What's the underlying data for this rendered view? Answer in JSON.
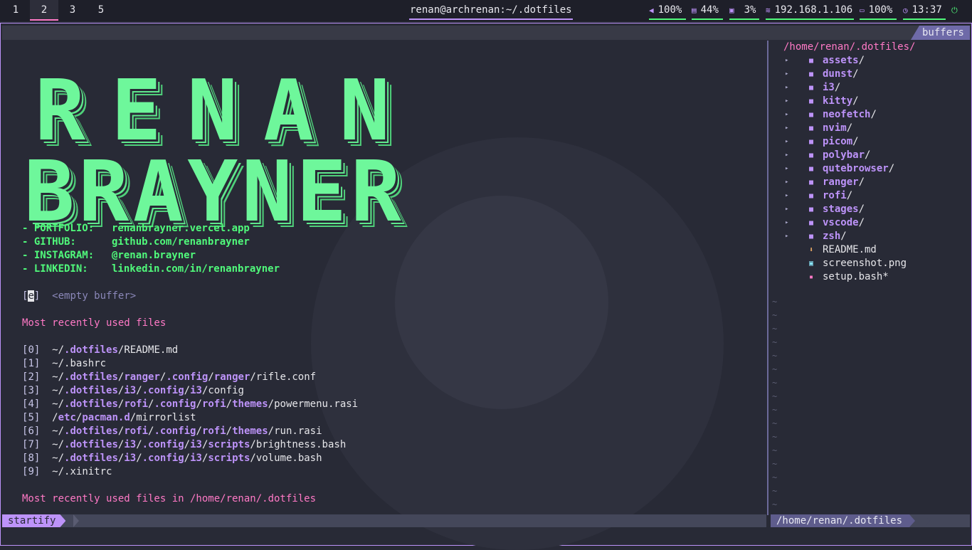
{
  "topbar": {
    "workspaces": [
      "1",
      "2",
      "3",
      "5"
    ],
    "active_workspace": "2",
    "window_title": "renan@archrenan:~/.dotfiles",
    "modules": {
      "volume": "100%",
      "memory": "44%",
      "cpu": "3%",
      "network": "192.168.1.106",
      "battery": "100%",
      "clock": "13:37"
    }
  },
  "tabline": {
    "buffers_label": "buffers"
  },
  "banner": {
    "line1": [
      "R",
      "E",
      "N",
      "A",
      "N"
    ],
    "line2": [
      "B",
      "R",
      "A",
      "Y",
      "N",
      "E",
      "R"
    ]
  },
  "info": [
    {
      "key": "- PORTFOLIO:",
      "value": "renanbrayner.vercel.app"
    },
    {
      "key": "- GITHUB:",
      "value": "github.com/renanbrayner"
    },
    {
      "key": "- INSTAGRAM:",
      "value": "@renan.brayner"
    },
    {
      "key": "- LINKEDIN:",
      "value": "linkedin.com/in/renanbrayner"
    }
  ],
  "empty_buffer": {
    "key": "e",
    "label": "<empty buffer>"
  },
  "mru": {
    "heading": "Most recently used files",
    "files": [
      {
        "index": "0",
        "parts": [
          [
            "~/",
            "p"
          ],
          [
            ".dotfiles",
            "d"
          ],
          [
            "/README.md",
            "p"
          ]
        ]
      },
      {
        "index": "1",
        "parts": [
          [
            "~/.bashrc",
            "p"
          ]
        ]
      },
      {
        "index": "2",
        "parts": [
          [
            "~/",
            "p"
          ],
          [
            ".dotfiles",
            "d"
          ],
          [
            "/",
            "p"
          ],
          [
            "ranger",
            "d"
          ],
          [
            "/",
            "p"
          ],
          [
            ".config",
            "d"
          ],
          [
            "/",
            "p"
          ],
          [
            "ranger",
            "d"
          ],
          [
            "/rifle.conf",
            "p"
          ]
        ]
      },
      {
        "index": "3",
        "parts": [
          [
            "~/",
            "p"
          ],
          [
            ".dotfiles",
            "d"
          ],
          [
            "/",
            "p"
          ],
          [
            "i3",
            "d"
          ],
          [
            "/",
            "p"
          ],
          [
            ".config",
            "d"
          ],
          [
            "/",
            "p"
          ],
          [
            "i3",
            "d"
          ],
          [
            "/config",
            "p"
          ]
        ]
      },
      {
        "index": "4",
        "parts": [
          [
            "~/",
            "p"
          ],
          [
            ".dotfiles",
            "d"
          ],
          [
            "/",
            "p"
          ],
          [
            "rofi",
            "d"
          ],
          [
            "/",
            "p"
          ],
          [
            ".config",
            "d"
          ],
          [
            "/",
            "p"
          ],
          [
            "rofi",
            "d"
          ],
          [
            "/",
            "p"
          ],
          [
            "themes",
            "d"
          ],
          [
            "/powermenu.rasi",
            "p"
          ]
        ]
      },
      {
        "index": "5",
        "parts": [
          [
            "/",
            "p"
          ],
          [
            "etc",
            "d"
          ],
          [
            "/",
            "p"
          ],
          [
            "pacman.d",
            "d"
          ],
          [
            "/mirrorlist",
            "p"
          ]
        ]
      },
      {
        "index": "6",
        "parts": [
          [
            "~/",
            "p"
          ],
          [
            ".dotfiles",
            "d"
          ],
          [
            "/",
            "p"
          ],
          [
            "rofi",
            "d"
          ],
          [
            "/",
            "p"
          ],
          [
            ".config",
            "d"
          ],
          [
            "/",
            "p"
          ],
          [
            "rofi",
            "d"
          ],
          [
            "/",
            "p"
          ],
          [
            "themes",
            "d"
          ],
          [
            "/run.rasi",
            "p"
          ]
        ]
      },
      {
        "index": "7",
        "parts": [
          [
            "~/",
            "p"
          ],
          [
            ".dotfiles",
            "d"
          ],
          [
            "/",
            "p"
          ],
          [
            "i3",
            "d"
          ],
          [
            "/",
            "p"
          ],
          [
            ".config",
            "d"
          ],
          [
            "/",
            "p"
          ],
          [
            "i3",
            "d"
          ],
          [
            "/",
            "p"
          ],
          [
            "scripts",
            "d"
          ],
          [
            "/brightness.bash",
            "p"
          ]
        ]
      },
      {
        "index": "8",
        "parts": [
          [
            "~/",
            "p"
          ],
          [
            ".dotfiles",
            "d"
          ],
          [
            "/",
            "p"
          ],
          [
            "i3",
            "d"
          ],
          [
            "/",
            "p"
          ],
          [
            ".config",
            "d"
          ],
          [
            "/",
            "p"
          ],
          [
            "i3",
            "d"
          ],
          [
            "/",
            "p"
          ],
          [
            "scripts",
            "d"
          ],
          [
            "/volume.bash",
            "p"
          ]
        ]
      },
      {
        "index": "9",
        "parts": [
          [
            "~/.xinitrc",
            "p"
          ]
        ]
      }
    ],
    "heading_dir": "Most recently used files in /home/renan/.dotfiles"
  },
  "tree": {
    "root": "/home/renan/.dotfiles/",
    "dirs": [
      "assets",
      "dunst",
      "i3",
      "kitty",
      "neofetch",
      "nvim",
      "picom",
      "polybar",
      "qutebrowser",
      "ranger",
      "rofi",
      "stages",
      "vscode",
      "zsh"
    ],
    "files": [
      {
        "name": "README.md",
        "icon": "download-icon",
        "color": "#ffb86c"
      },
      {
        "name": "screenshot.png",
        "icon": "image-icon",
        "color": "#8be9fd"
      },
      {
        "name": "setup.bash*",
        "icon": "terminal-icon",
        "color": "#ff79c6"
      }
    ]
  },
  "statusline": {
    "left_mode": "startify",
    "right_path": "/home/renan/.dotfiles"
  },
  "colors": {
    "accent": "#bd93f9",
    "green": "#50fa7b",
    "pink": "#ff79c6",
    "background": "#282a36"
  }
}
